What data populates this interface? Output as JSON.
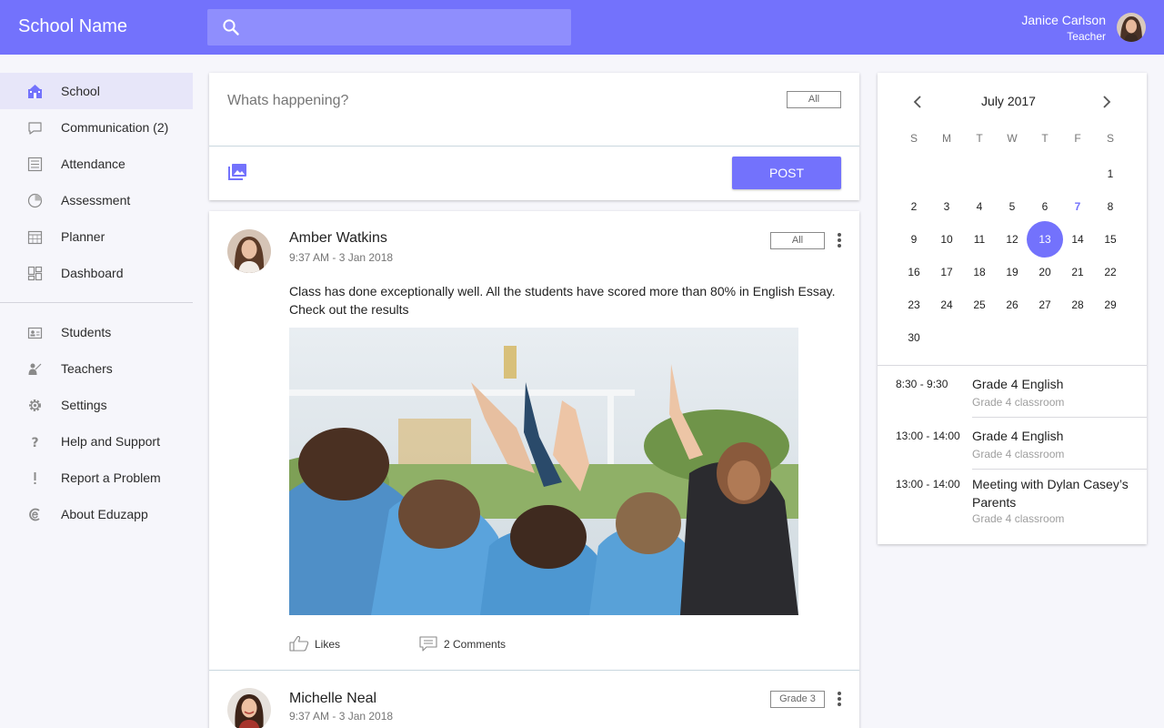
{
  "header": {
    "brand": "School Name",
    "search_icon": "search-icon",
    "user": {
      "name": "Janice Carlson",
      "role": "Teacher"
    }
  },
  "sidebar": {
    "primary": [
      {
        "label": "School",
        "icon": "school-icon",
        "active": true
      },
      {
        "label": "Communication (2)",
        "icon": "chat-bubble-icon"
      },
      {
        "label": "Attendance",
        "icon": "list-icon"
      },
      {
        "label": "Assessment",
        "icon": "pie-chart-icon"
      },
      {
        "label": "Planner",
        "icon": "calendar-grid-icon"
      },
      {
        "label": "Dashboard",
        "icon": "dashboard-icon"
      }
    ],
    "secondary": [
      {
        "label": "Students",
        "icon": "id-card-icon"
      },
      {
        "label": "Teachers",
        "icon": "teacher-icon"
      },
      {
        "label": "Settings",
        "icon": "gear-icon"
      },
      {
        "label": "Help and Support",
        "icon": "question-icon"
      },
      {
        "label": "Report a Problem",
        "icon": "exclamation-icon"
      },
      {
        "label": "About Eduzapp",
        "icon": "about-icon"
      }
    ]
  },
  "composer": {
    "placeholder": "Whats happening?",
    "audience": "All",
    "post_button": "POST",
    "image_icon": "image-icon"
  },
  "feed": {
    "posts": [
      {
        "author": "Amber Watkins",
        "time": "9:37 AM - 3 Jan 2018",
        "audience": "All",
        "text": "Class has done exceptionally well. All the students have scored more than 80% in English Essay. Check out the results",
        "likes_label": "Likes",
        "comments_label": "2 Comments"
      },
      {
        "author": "Michelle Neal",
        "time": "9:37 AM - 3 Jan 2018",
        "audience": "Grade 3"
      }
    ]
  },
  "calendar": {
    "month": "July 2017",
    "weekdays": [
      "S",
      "M",
      "T",
      "W",
      "T",
      "F",
      "S"
    ],
    "today": 7,
    "selected": 13,
    "events": [
      {
        "time": "8:30 - 9:30",
        "title": "Grade 4 English",
        "location": "Grade 4 classroom"
      },
      {
        "time": "13:00 - 14:00",
        "title": "Grade 4 English",
        "location": "Grade 4 classroom"
      },
      {
        "time": "13:00 - 14:00",
        "title": "Meeting with Dylan Casey’s Parents",
        "location": "Grade 4 classroom"
      }
    ]
  },
  "colors": {
    "accent": "#7372fc",
    "accent_light": "#8f8efd",
    "active_nav": "#e7e6f9"
  }
}
